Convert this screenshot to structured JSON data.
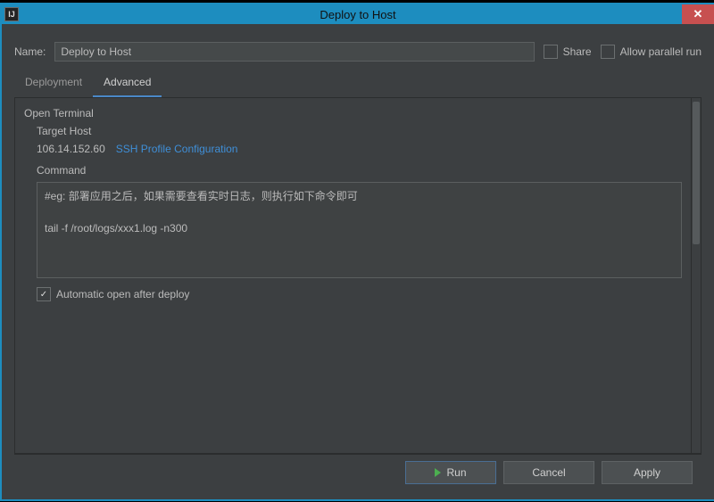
{
  "window": {
    "title": "Deploy to Host",
    "icon_label": "IJ",
    "close_tooltip": "Close"
  },
  "form": {
    "name_label": "Name:",
    "name_value": "Deploy to Host",
    "share_label": "Share",
    "share_checked": false,
    "parallel_label": "Allow parallel run",
    "parallel_checked": false
  },
  "tabs": [
    {
      "label": "Deployment",
      "active": false
    },
    {
      "label": "Advanced",
      "active": true
    }
  ],
  "advanced": {
    "open_terminal_heading": "Open Terminal",
    "target_host_label": "Target Host",
    "target_host_ip": "106.14.152.60",
    "ssh_profile_link": "SSH Profile Configuration",
    "command_label": "Command",
    "command_text": "#eg: 部署应用之后，如果需要查看实时日志，则执行如下命令即可\n\ntail -f /root/logs/xxx1.log -n300",
    "auto_open_label": "Automatic open after deploy",
    "auto_open_checked": true
  },
  "buttons": {
    "run": "Run",
    "cancel": "Cancel",
    "apply": "Apply"
  }
}
